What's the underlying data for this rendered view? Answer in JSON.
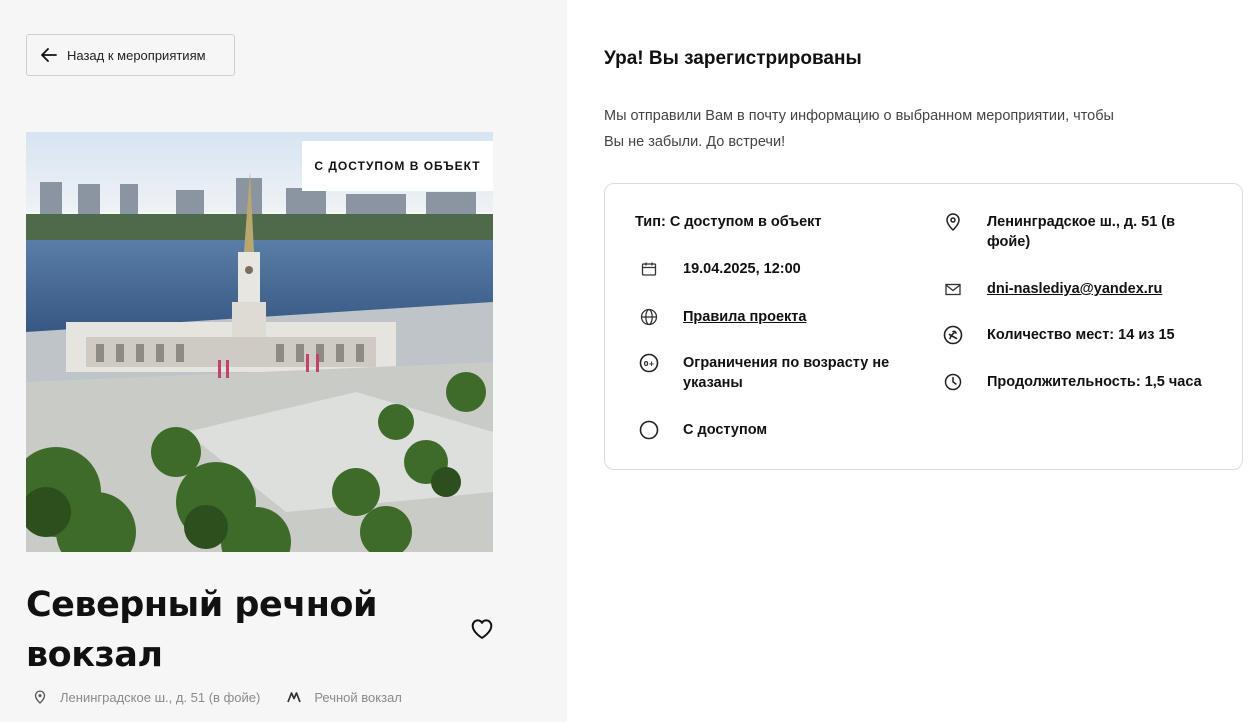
{
  "back_button": {
    "label": "Назад к мероприятиям",
    "icon": "arrow-left-icon"
  },
  "event": {
    "badge": "С ДОСТУПОМ В ОБЪЕКТ",
    "title": "Северный речной вокзал",
    "address": "Ленинградское ш., д. 51 (в фойе)",
    "metro": "Речной вокзал"
  },
  "confirmation": {
    "title": "Ура! Вы зарегистрированы",
    "text": "Мы отправили Вам в почту информацию о выбранном мероприятии, чтобы Вы не забыли. До встречи!"
  },
  "details": {
    "type": "Тип: С доступом в объект",
    "date": "19.04.2025, 12:00",
    "rules_link": "Правила проекта",
    "age": "Ограничения по возрасту не указаны",
    "access": "С доступом",
    "address": "Ленинградское ш., д. 51 (в фойе)",
    "email": "dni-naslediya@yandex.ru",
    "seats": "Количество мест: 14 из 15",
    "duration": "Продолжительность: 1,5 часа"
  },
  "icons": [
    "arrow-left-icon",
    "heart-icon",
    "location-pin-icon",
    "metro-icon",
    "calendar-icon",
    "globe-icon",
    "age-restriction-icon",
    "circle-icon",
    "mail-icon",
    "seats-icon",
    "clock-icon"
  ],
  "colors": {
    "left_background": "#f6f6f6",
    "card_border": "#dcdcdc",
    "water": "#3d5f8c",
    "greenery": "#3f6b2a"
  }
}
